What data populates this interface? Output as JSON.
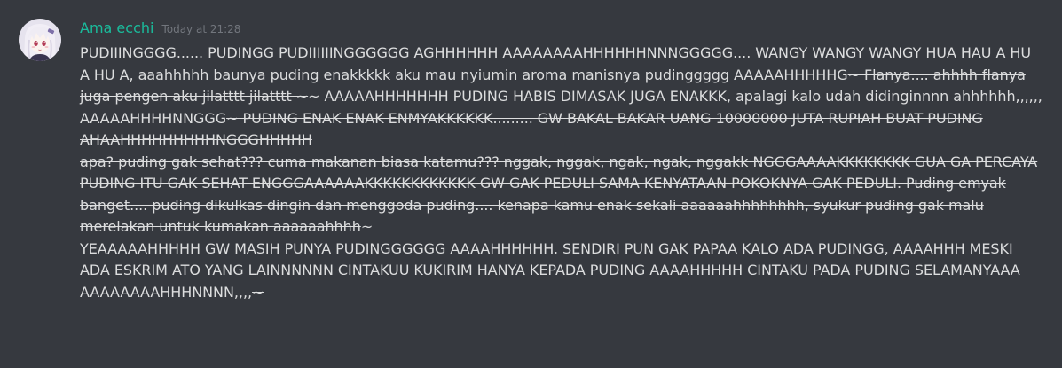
{
  "message": {
    "author": "Ama ecchi",
    "timestamp": "Today at 21:28",
    "username_color": "#1abc9c",
    "background_color": "#36393f",
    "text_color": "#dcddde",
    "avatar": "anime-girl-avatar",
    "segments": [
      {
        "text": "PUDIIINGGGG...... PUDINGG PUDIIIIIINGGGGGG AGHHHHHH AAAAAAAAHHHHHHNNNGGGGG.... WANGY WANGY WANGY HUA HAU A HU A HU A, aaahhhhh baunya puding enakkkkk aku mau nyiumin aroma manisnya pudinggggg AAAAAHHHHHG",
        "strike": false
      },
      {
        "text": "~ Flanya.... ahhhh flanya juga pengen aku jilatttt jilatttt ~",
        "strike": true
      },
      {
        "text": "~ AAAAAHHHHHHH PUDING HABIS DIMASAK JUGA ENAKKK, apalagi kalo udah didinginnnn ahhhhhh,,,,,, AAAAAHHHHNNGGG",
        "strike": false
      },
      {
        "text": "~ PUDING ENAK ENAK ENMYAKKKKKK......... GW BAKAL BAKAR UANG 10000000 JUTA RUPIAH BUAT PUDING AHAAHHHHHHHHHNGGGHHHHH\napa? puding gak sehat??? cuma makanan biasa katamu??? nggak, nggak, ngak, ngak, nggakk NGGGAAAAKKKKKKKK GUA GA PERCAYA PUDING ITU GAK SEHAT ENGGGAAAAAAKKKKKKKKKKKK GW  GAK PEDULI SAMA KENYATAAN POKOKNYA GAK PEDULI. Puding emyak banget.... puding dikulkas dingin dan menggoda puding.... kenapa kamu enak sekali aaaaaahhhhhhhh, syukur puding gak malu merelakan untuk kumakan aaaaaahhhh",
        "strike": true
      },
      {
        "text": "~\nYEAAAAAHHHHH GW MASIH PUNYA PUDINGGGGGG AAAAHHHHHH. SENDIRI PUN GAK PAPAA KALO ADA PUDINGG, AAAAHHH MESKI ADA ESKRIM ATO YANG LAINNNNNN CINTAKUU KUKIRIM HANYA KEPADA PUDING AAAAHHHHH CINTAKU PADA PUDING SELAMANYAAA AAAAAAAAHHHNNNN,,,,",
        "strike": false
      },
      {
        "text": "~",
        "strike": true
      }
    ]
  }
}
